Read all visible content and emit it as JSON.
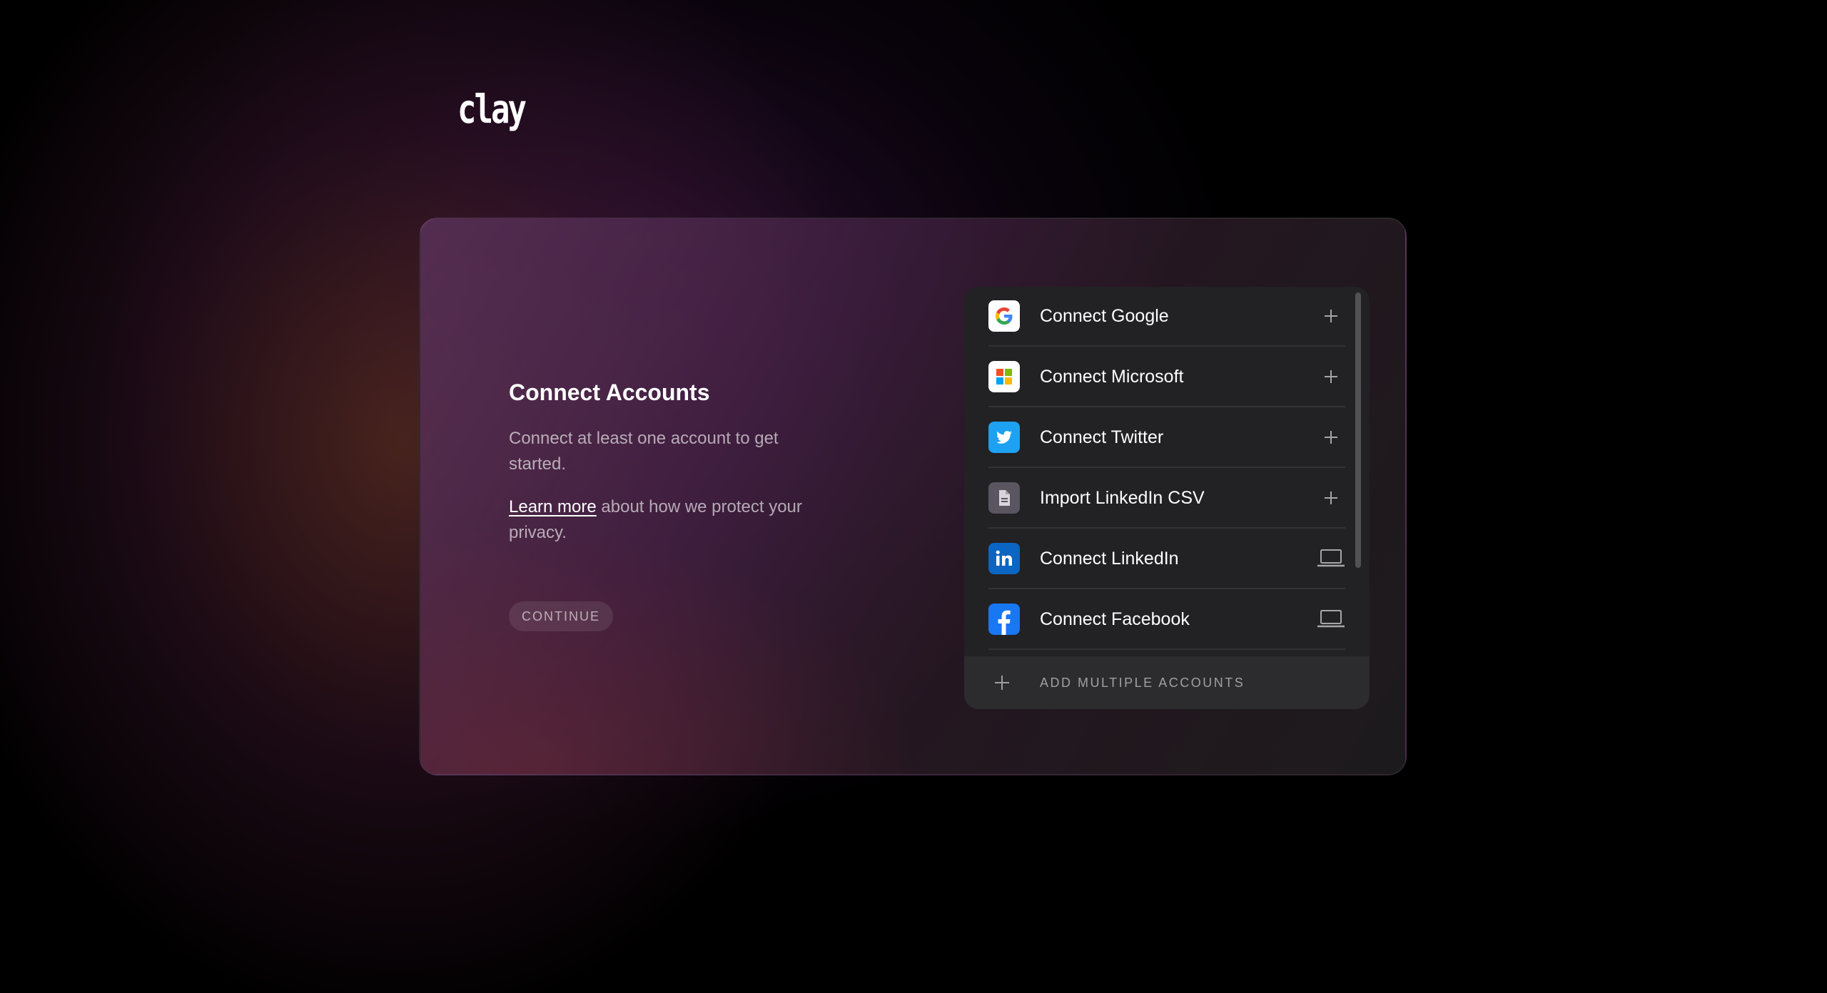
{
  "brand": {
    "logo_text": "clay"
  },
  "intro": {
    "title": "Connect Accounts",
    "description": "Connect at least one account to get started.",
    "learn_more_link": "Learn more",
    "privacy_text": " about how we protect your privacy.",
    "continue_label": "CONTINUE"
  },
  "accounts": [
    {
      "label": "Connect Google",
      "icon": "google-icon",
      "action": "plus-icon"
    },
    {
      "label": "Connect Microsoft",
      "icon": "microsoft-icon",
      "action": "plus-icon"
    },
    {
      "label": "Connect Twitter",
      "icon": "twitter-icon",
      "action": "plus-icon"
    },
    {
      "label": "Import LinkedIn CSV",
      "icon": "csv-file-icon",
      "action": "plus-icon"
    },
    {
      "label": "Connect LinkedIn",
      "icon": "linkedin-icon",
      "action": "laptop-icon"
    },
    {
      "label": "Connect Facebook",
      "icon": "facebook-icon",
      "action": "laptop-icon"
    }
  ],
  "footer": {
    "add_multiple_label": "ADD MULTIPLE ACCOUNTS"
  },
  "colors": {
    "twitter": "#1DA1F2",
    "linkedin": "#0A66C2",
    "facebook": "#1877F2",
    "csv_icon_bg": "#5a5560"
  }
}
